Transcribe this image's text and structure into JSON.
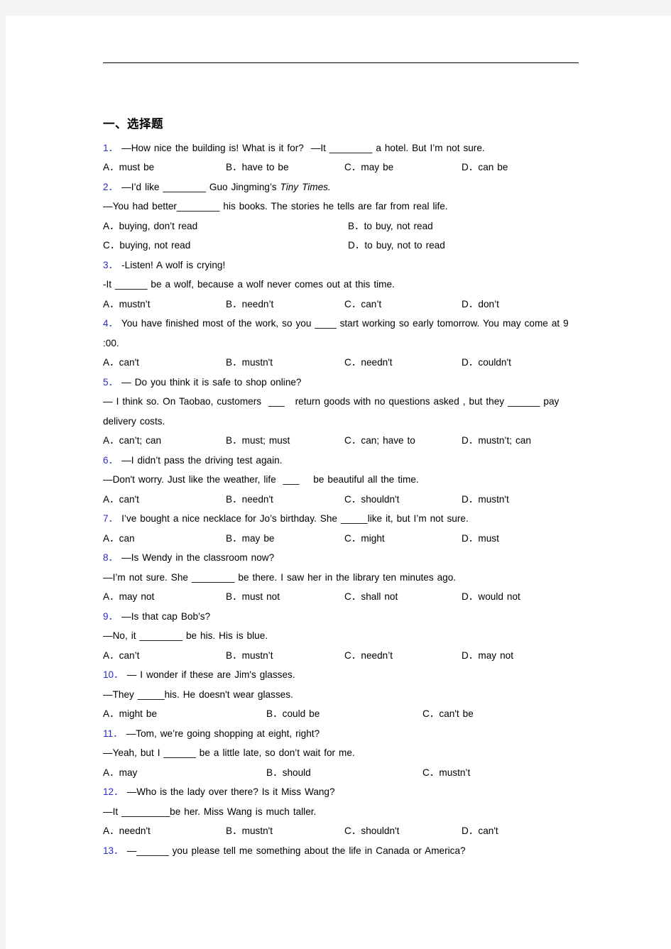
{
  "document": {
    "section_heading": "一、选择题",
    "questions": [
      {
        "number": "1．",
        "lines": [
          "—How nice the building is! What is it for?  —It ________ a hotel. But I’m not sure."
        ],
        "options": [
          "A．must be",
          "B．have to be",
          "C．may be",
          "D．can be"
        ],
        "columns": 4
      },
      {
        "number": "2．",
        "lines": [
          "—I’d like ________ Guo Jingming’s ",
          "—You had better________ his books. The stories he tells are far from real life."
        ],
        "italic_tail": "Tiny Times.",
        "options": [
          "A．buying, don’t read",
          "B．to buy, not read",
          "C．buying, not read",
          "D．to buy, not to read"
        ],
        "columns": 2
      },
      {
        "number": "3．",
        "lines": [
          "-Listen! A wolf is crying!",
          "-It ______ be a wolf, because a wolf never comes out at this time."
        ],
        "options": [
          "A．mustn’t",
          "B．needn’t",
          "C．can’t",
          "D．don’t"
        ],
        "columns": 4
      },
      {
        "number": "4．",
        "lines": [
          "You have finished most of the work, so you ____ start working so early tomorrow. You may come at 9 :00."
        ],
        "options": [
          "A．can't",
          "B．mustn't",
          "C．needn't",
          "D．couldn't"
        ],
        "columns": 4
      },
      {
        "number": "5．",
        "lines": [
          "— Do you think it is safe to shop online?",
          "— I think so. On Taobao, customers  ___   return goods with no questions asked , but they ______ pay delivery costs."
        ],
        "options": [
          "A．can’t; can",
          "B．must; must",
          "C．can; have to",
          "D．mustn’t; can"
        ],
        "columns": 4
      },
      {
        "number": "6．",
        "lines": [
          "—I didn’t pass the driving test again.",
          "—Don't worry. Just like the weather, life  ___    be beautiful all the time."
        ],
        "options": [
          "A．can't",
          "B．needn't",
          "C．shouldn't",
          "D．mustn't"
        ],
        "columns": 4
      },
      {
        "number": "7．",
        "lines": [
          "I’ve bought a nice necklace for Jo’s birthday. She _____like it, but I’m not sure."
        ],
        "options": [
          "A．can",
          "B．may be",
          "C．might",
          "D．must"
        ],
        "columns": 4
      },
      {
        "number": "8．",
        "lines": [
          "—Is Wendy in the classroom now?",
          "—I’m not sure. She ________ be there. I saw her in the library ten minutes ago."
        ],
        "options": [
          "A．may not",
          "B．must not",
          "C．shall not",
          "D．would not"
        ],
        "columns": 4
      },
      {
        "number": "9．",
        "lines": [
          "—Is that cap Bob’s?",
          "—No, it ________ be his. His is blue."
        ],
        "options": [
          "A．can’t",
          "B．mustn’t",
          "C．needn’t",
          "D．may not"
        ],
        "columns": 4
      },
      {
        "number": "10．",
        "lines": [
          "— I wonder if these are Jim's glasses.",
          "—They _____his. He doesn't wear glasses."
        ],
        "options": [
          "A．might be",
          "B．could be",
          "C．can't be"
        ],
        "columns": 3
      },
      {
        "number": "11．",
        "lines": [
          "—Tom, we’re going shopping at eight, right?",
          "—Yeah, but I ______ be a little late, so don’t wait for me."
        ],
        "options": [
          "A．may",
          "B．should",
          "C．mustn’t"
        ],
        "columns": 3
      },
      {
        "number": "12．",
        "lines": [
          "—Who is the lady over there? Is it Miss Wang?",
          "—It _________be her. Miss Wang is much taller."
        ],
        "options": [
          "A．needn't",
          "B．mustn't",
          "C．shouldn't",
          "D．can't"
        ],
        "columns": 4
      },
      {
        "number": "13．",
        "lines": [
          "—______ you please tell me something about the life in Canada or America?"
        ],
        "options": [],
        "columns": 4
      }
    ]
  }
}
